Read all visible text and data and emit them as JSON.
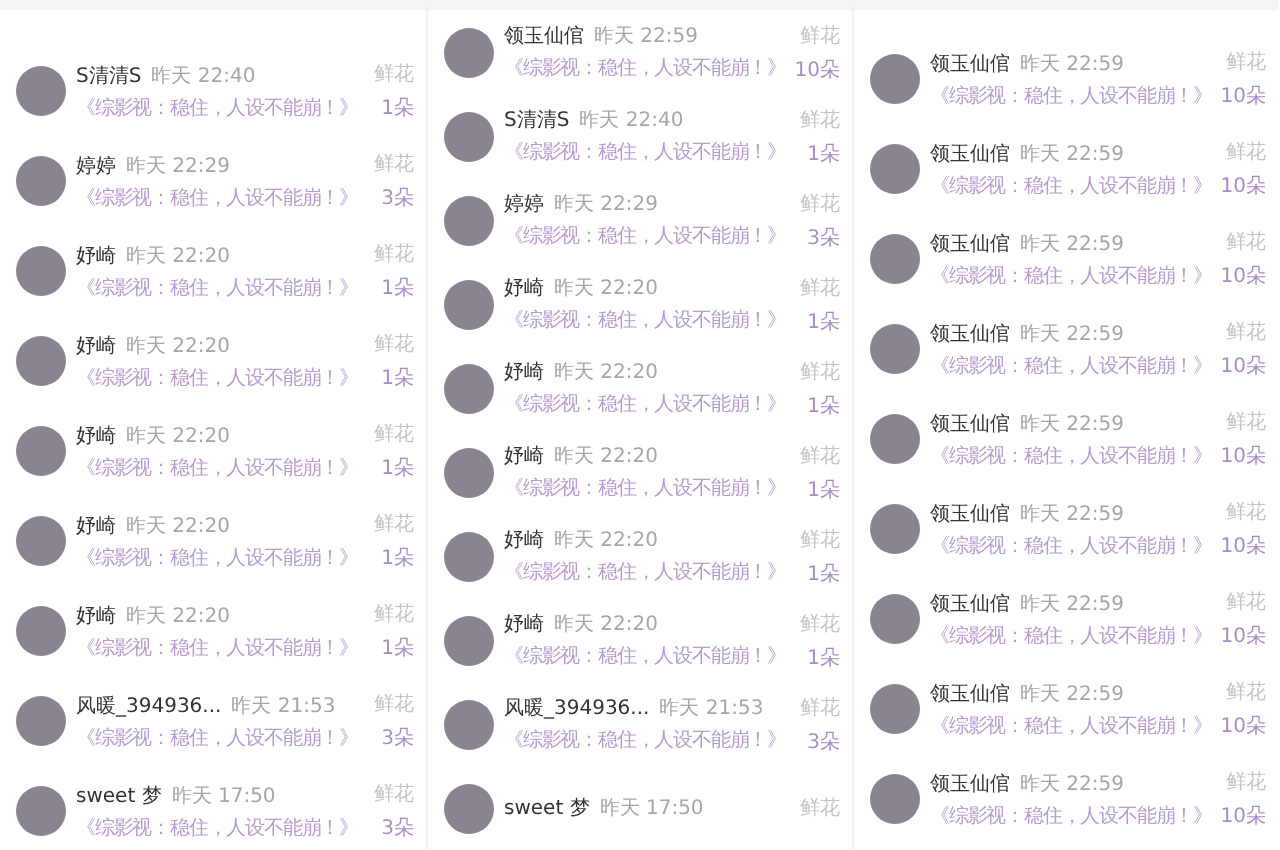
{
  "panels": [
    {
      "rows": [
        {
          "name": "S清清S",
          "time": "昨天 22:40",
          "message": "《综影视：稳住，人设不能崩！》",
          "label": "鲜花",
          "count": "1朵"
        },
        {
          "name": "婷婷",
          "time": "昨天 22:29",
          "message": "《综影视：稳住，人设不能崩！》",
          "label": "鲜花",
          "count": "3朵"
        },
        {
          "name": "妤崎",
          "time": "昨天 22:20",
          "message": "《综影视：稳住，人设不能崩！》",
          "label": "鲜花",
          "count": "1朵"
        },
        {
          "name": "妤崎",
          "time": "昨天 22:20",
          "message": "《综影视：稳住，人设不能崩！》",
          "label": "鲜花",
          "count": "1朵"
        },
        {
          "name": "妤崎",
          "time": "昨天 22:20",
          "message": "《综影视：稳住，人设不能崩！》",
          "label": "鲜花",
          "count": "1朵"
        },
        {
          "name": "妤崎",
          "time": "昨天 22:20",
          "message": "《综影视：稳住，人设不能崩！》",
          "label": "鲜花",
          "count": "1朵"
        },
        {
          "name": "妤崎",
          "time": "昨天 22:20",
          "message": "《综影视：稳住，人设不能崩！》",
          "label": "鲜花",
          "count": "1朵"
        },
        {
          "name": "风暖_394936...",
          "time": "昨天 21:53",
          "message": "《综影视：稳住，人设不能崩！》",
          "label": "鲜花",
          "count": "3朵"
        },
        {
          "name": "sweet 梦",
          "time": "昨天 17:50",
          "message": "《综影视：稳住，人设不能崩！》",
          "label": "鲜花",
          "count": "3朵"
        }
      ]
    },
    {
      "rows": [
        {
          "name": "领玉仙倌",
          "time": "昨天 22:59",
          "message": "《综影视：稳住，人设不能崩！》",
          "label": "鲜花",
          "count": "10朵"
        },
        {
          "name": "S清清S",
          "time": "昨天 22:40",
          "message": "《综影视：稳住，人设不能崩！》",
          "label": "鲜花",
          "count": "1朵"
        },
        {
          "name": "婷婷",
          "time": "昨天 22:29",
          "message": "《综影视：稳住，人设不能崩！》",
          "label": "鲜花",
          "count": "3朵"
        },
        {
          "name": "妤崎",
          "time": "昨天 22:20",
          "message": "《综影视：稳住，人设不能崩！》",
          "label": "鲜花",
          "count": "1朵"
        },
        {
          "name": "妤崎",
          "time": "昨天 22:20",
          "message": "《综影视：稳住，人设不能崩！》",
          "label": "鲜花",
          "count": "1朵"
        },
        {
          "name": "妤崎",
          "time": "昨天 22:20",
          "message": "《综影视：稳住，人设不能崩！》",
          "label": "鲜花",
          "count": "1朵"
        },
        {
          "name": "妤崎",
          "time": "昨天 22:20",
          "message": "《综影视：稳住，人设不能崩！》",
          "label": "鲜花",
          "count": "1朵"
        },
        {
          "name": "妤崎",
          "time": "昨天 22:20",
          "message": "《综影视：稳住，人设不能崩！》",
          "label": "鲜花",
          "count": "1朵"
        },
        {
          "name": "风暖_394936...",
          "time": "昨天 21:53",
          "message": "《综影视：稳住，人设不能崩！》",
          "label": "鲜花",
          "count": "3朵"
        },
        {
          "name": "sweet 梦",
          "time": "昨天 17:50",
          "label": "鲜花"
        }
      ]
    },
    {
      "rows": [
        {
          "name": "领玉仙倌",
          "time": "昨天 22:59",
          "message": "《综影视：稳住，人设不能崩！》",
          "label": "鲜花",
          "count": "10朵"
        },
        {
          "name": "领玉仙倌",
          "time": "昨天 22:59",
          "message": "《综影视：稳住，人设不能崩！》",
          "label": "鲜花",
          "count": "10朵"
        },
        {
          "name": "领玉仙倌",
          "time": "昨天 22:59",
          "message": "《综影视：稳住，人设不能崩！》",
          "label": "鲜花",
          "count": "10朵"
        },
        {
          "name": "领玉仙倌",
          "time": "昨天 22:59",
          "message": "《综影视：稳住，人设不能崩！》",
          "label": "鲜花",
          "count": "10朵"
        },
        {
          "name": "领玉仙倌",
          "time": "昨天 22:59",
          "message": "《综影视：稳住，人设不能崩！》",
          "label": "鲜花",
          "count": "10朵"
        },
        {
          "name": "领玉仙倌",
          "time": "昨天 22:59",
          "message": "《综影视：稳住，人设不能崩！》",
          "label": "鲜花",
          "count": "10朵"
        },
        {
          "name": "领玉仙倌",
          "time": "昨天 22:59",
          "message": "《综影视：稳住，人设不能崩！》",
          "label": "鲜花",
          "count": "10朵"
        },
        {
          "name": "领玉仙倌",
          "time": "昨天 22:59",
          "message": "《综影视：稳住，人设不能崩！》",
          "label": "鲜花",
          "count": "10朵"
        },
        {
          "name": "领玉仙倌",
          "time": "昨天 22:59",
          "message": "《综影视：稳住，人设不能崩！》",
          "label": "鲜花",
          "count": "10朵"
        }
      ]
    }
  ]
}
